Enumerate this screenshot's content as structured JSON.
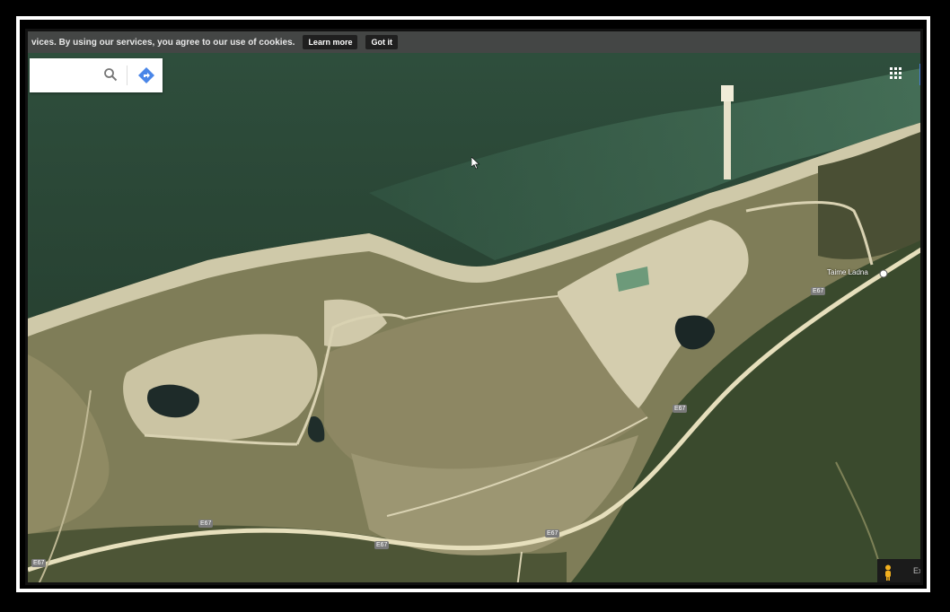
{
  "cookie_bar": {
    "text": "vices. By using our services, you agree to our use of cookies.",
    "learn_more": "Learn more",
    "got_it": "Got it"
  },
  "search": {
    "value": "",
    "placeholder": ""
  },
  "icons": [
    "search-icon",
    "directions-icon",
    "apps-grid-icon",
    "pegman-icon",
    "cursor-icon"
  ],
  "road_labels": [
    "E67",
    "E67",
    "E67",
    "E67",
    "E67",
    "E67"
  ],
  "place_label": "Taime Ladna",
  "pegman_label": "Ex",
  "colors": {
    "sea_deep": "#24402f",
    "sea_shallow": "#3f6a52",
    "beach": "#d7d2b6",
    "quarry": "#cfc8a8",
    "field": "#8e8a63",
    "forest": "#3d4a2c",
    "road": "#e8e0bd",
    "pond": "#1d2a28"
  }
}
